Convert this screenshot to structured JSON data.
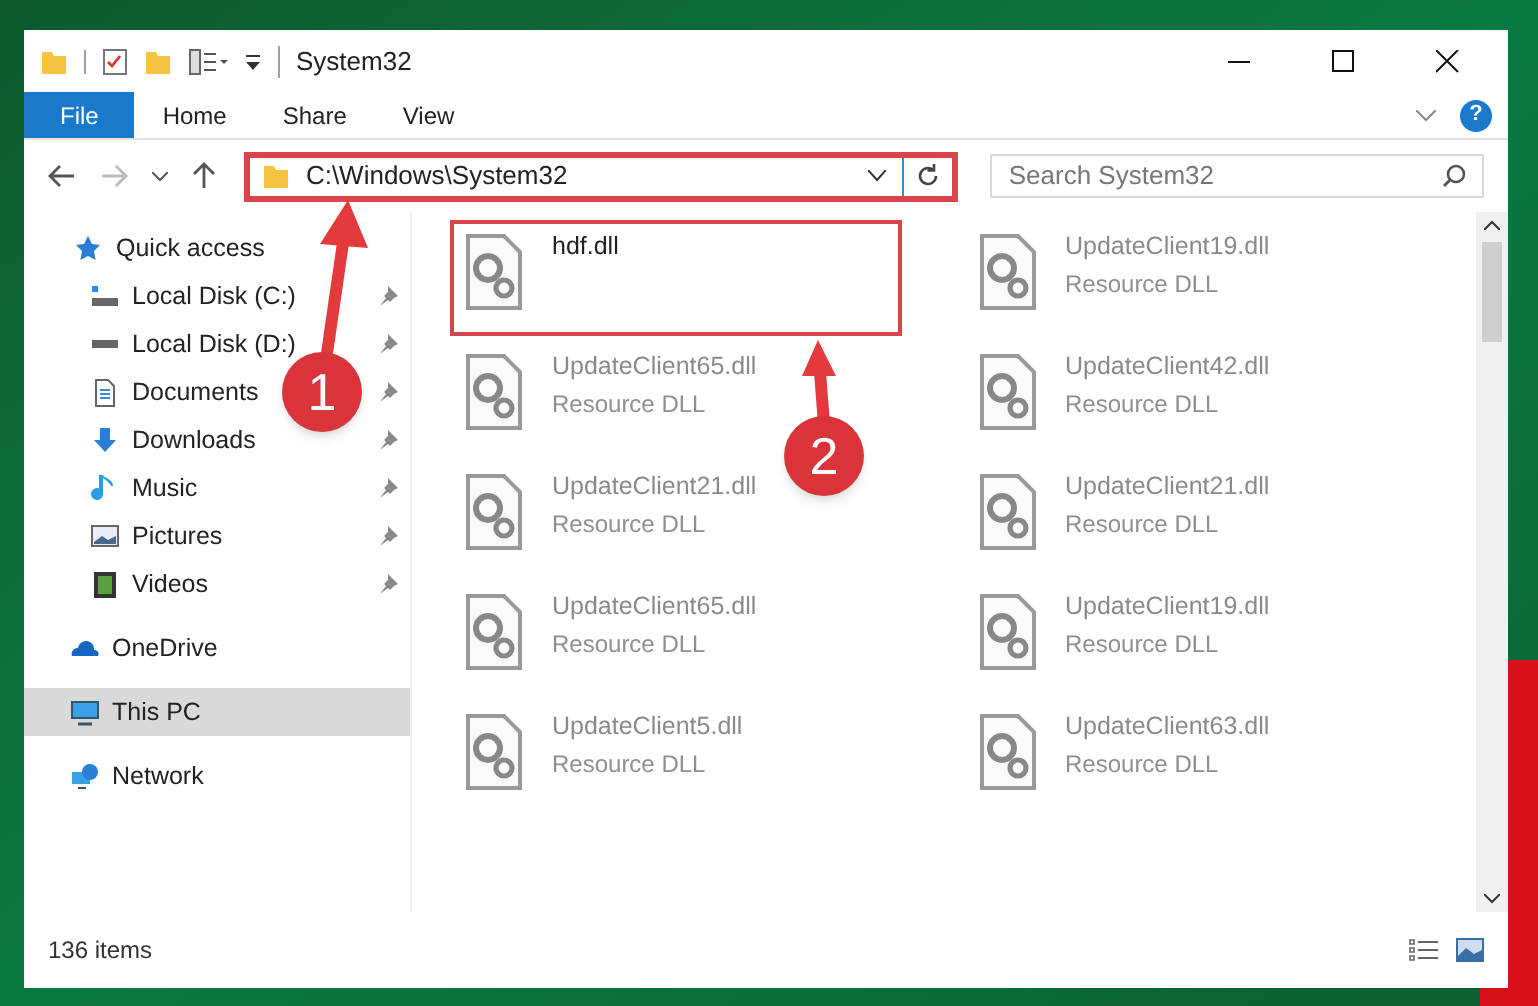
{
  "window": {
    "title": "System32"
  },
  "ribbon_tabs": [
    {
      "label": "File",
      "selected": true
    },
    {
      "label": "Home",
      "selected": false
    },
    {
      "label": "Share",
      "selected": false
    },
    {
      "label": "View",
      "selected": false
    }
  ],
  "help_button": "?",
  "address": {
    "path": "C:\\Windows\\System32",
    "highlighted": true
  },
  "search": {
    "placeholder": "Search System32"
  },
  "sidebar": {
    "items": [
      {
        "label": "Quick access",
        "kind": "quick",
        "pinned": false,
        "selected": false
      },
      {
        "label": "Local Disk (C:)",
        "kind": "diskc",
        "pinned": true,
        "selected": false
      },
      {
        "label": "Local Disk (D:)",
        "kind": "disk",
        "pinned": true,
        "selected": false
      },
      {
        "label": "Documents",
        "kind": "documents",
        "pinned": true,
        "selected": false
      },
      {
        "label": "Downloads",
        "kind": "downloads",
        "pinned": true,
        "selected": false
      },
      {
        "label": "Music",
        "kind": "music",
        "pinned": true,
        "selected": false
      },
      {
        "label": "Pictures",
        "kind": "pictures",
        "pinned": true,
        "selected": false
      },
      {
        "label": "Videos",
        "kind": "videos",
        "pinned": true,
        "selected": false
      },
      {
        "label": "OneDrive",
        "kind": "onedrive",
        "pinned": false,
        "selected": false
      },
      {
        "label": "This PC",
        "kind": "pc",
        "pinned": false,
        "selected": true
      },
      {
        "label": "Network",
        "kind": "network",
        "pinned": false,
        "selected": false
      }
    ]
  },
  "files": [
    {
      "name": "hdf.dll",
      "highlighted": true
    },
    {
      "name": "UpdateClient19.dll",
      "type": "Resource DLL",
      "highlighted": false
    },
    {
      "name": "UpdateClient65.dll",
      "type": "Resource DLL",
      "highlighted": false
    },
    {
      "name": "UpdateClient42.dll",
      "type": "Resource DLL",
      "highlighted": false
    },
    {
      "name": "UpdateClient21.dll",
      "type": "Resource DLL",
      "highlighted": false
    },
    {
      "name": "UpdateClient21.dll",
      "type": "Resource DLL",
      "highlighted": false
    },
    {
      "name": "UpdateClient65.dll",
      "type": "Resource DLL",
      "highlighted": false
    },
    {
      "name": "UpdateClient19.dll",
      "type": "Resource DLL",
      "highlighted": false
    },
    {
      "name": "UpdateClient5.dll",
      "type": "Resource DLL",
      "highlighted": false
    },
    {
      "name": "UpdateClient63.dll",
      "type": "Resource DLL",
      "highlighted": false
    }
  ],
  "status_bar": {
    "count": "136 items"
  },
  "annotations": [
    {
      "number": "1"
    },
    {
      "number": "2"
    }
  ]
}
